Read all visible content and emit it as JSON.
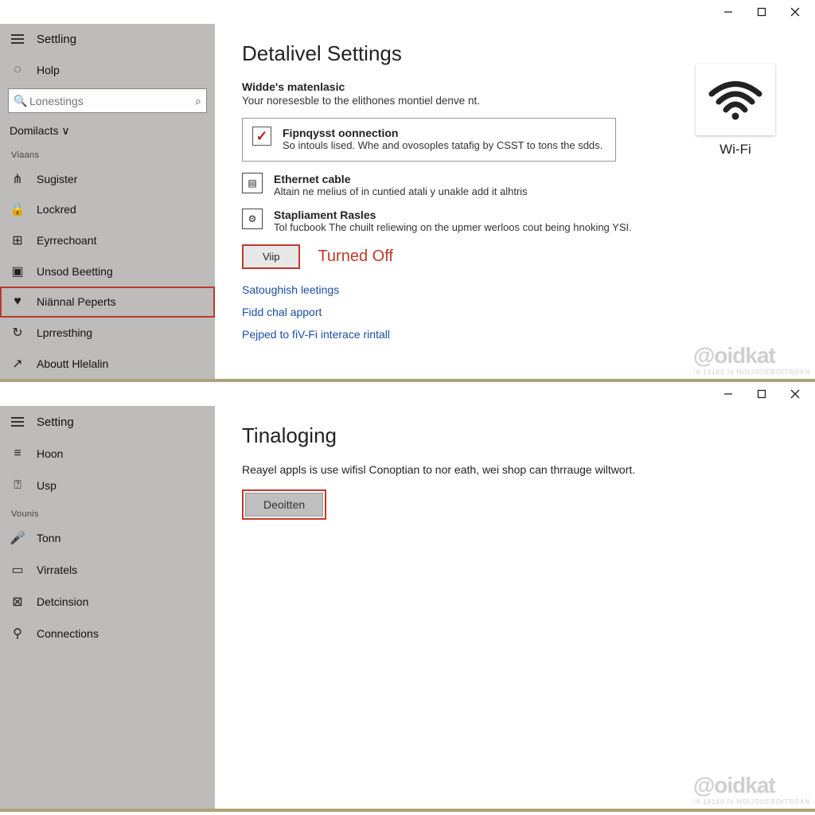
{
  "top": {
    "app_title": "Settling",
    "sidebar": {
      "help": "Holp",
      "search_placeholder": "Lonestings",
      "group1_label": "Domilacts ∨",
      "section1": "Viaans",
      "items": [
        "Sugister",
        "Lockred",
        "Eyrrechoant",
        "Unsod Beetting",
        "Niännal Peperts",
        "Lprresthing",
        "Aboutt Hlelalin"
      ],
      "selected_index": 4
    },
    "content": {
      "title": "Detalivel Settings",
      "matenlasic_title": "Widde's matenlasic",
      "matenlasic_desc": "Your noresesble to the elithones montiel denve nt.",
      "card_title": "Fipnqysst oonnection",
      "card_desc": "So intouls lised. Whe and ovosoples tatafig by CSST to tons the sdds.",
      "ethernet_title": "Ethernet cable",
      "ethernet_desc": "Altain ne melius of in cuntied atali y unakle add it alhtris",
      "rasles_title": "Stapliament Rasles",
      "rasles_desc": "Tol fucbook The chuilt reliewing on the upmer werloos cout being hnoking YSI.",
      "vip_btn": "Viip",
      "status": "Turned Off",
      "link1": "Satoughish leetings",
      "link2": "Fidd chal apport",
      "link3": "Pejped to fiV-Fi interace rintall",
      "wifi_label": "Wi-Fi"
    },
    "watermark": "@oidkat",
    "watermark_sub": "!A 18180 fo NOIJOUEROITSOAN"
  },
  "bot": {
    "app_title": "Setting",
    "sidebar": {
      "hoon": "Hoon",
      "usp": "Usp",
      "section": "Vounis",
      "items": [
        "Tonn",
        "Virratels",
        "Detcinsion",
        "Connections"
      ]
    },
    "content": {
      "title": "Tinaloging",
      "lead": "Reayel appls is use wifisl Conoptian to nor eath, wei shop can thrrauge wiltwort.",
      "btn": "Deoitten"
    },
    "watermark": "@oidkat",
    "watermark_sub": "!A 18180 fo NOIJOUEROITSOAN"
  }
}
